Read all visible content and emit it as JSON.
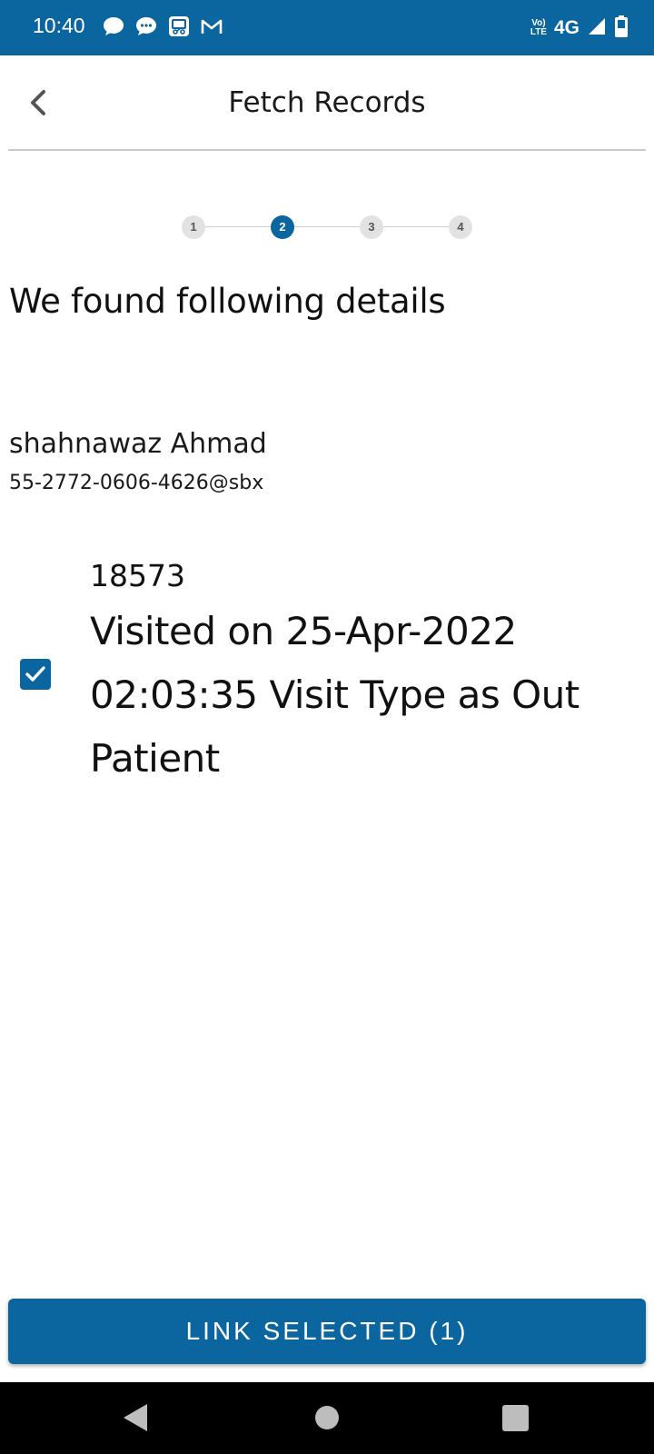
{
  "status_bar": {
    "time": "10:40",
    "volte_label": "Vo)\nLTE",
    "network": "4G",
    "notification_icons": [
      "chat-bubble-icon",
      "message-icon",
      "screen-share-icon",
      "gmail-icon"
    ],
    "background": "#0b66a0"
  },
  "app_bar": {
    "title": "Fetch Records",
    "back_icon": "chevron-left-icon"
  },
  "stepper": {
    "steps": [
      "1",
      "2",
      "3",
      "4"
    ],
    "active_step": 2,
    "active_color": "#0b66a0"
  },
  "content": {
    "heading": "We found following details",
    "patient_name": "shahnawaz Ahmad",
    "patient_id": "55-2772-0606-4626@sbx",
    "records": [
      {
        "number": "18573",
        "description": "Visited on 25-Apr-2022 02:03:35 Visit Type as Out Patient",
        "checked": true
      }
    ]
  },
  "actions": {
    "link_button_label": "LINK SELECTED (1)"
  },
  "nav_bar": {
    "icons": [
      "back-triangle-icon",
      "home-circle-icon",
      "recents-square-icon"
    ]
  }
}
